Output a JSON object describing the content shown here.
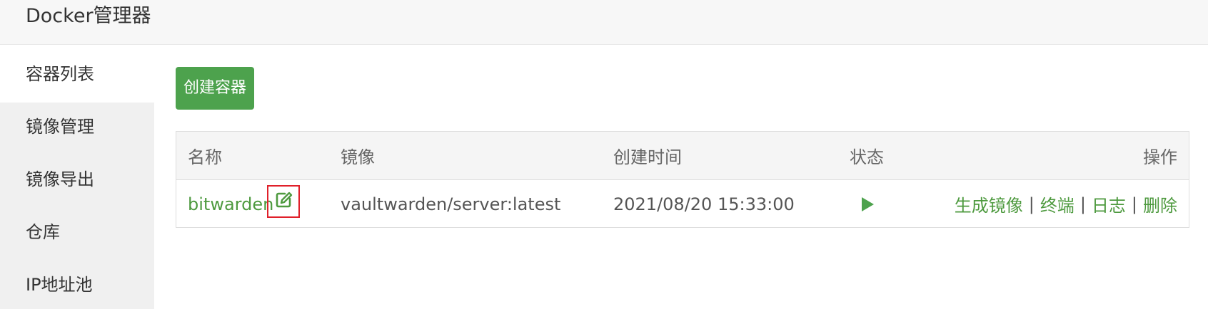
{
  "app": {
    "title": "Docker管理器"
  },
  "sidebar": {
    "items": [
      {
        "label": "容器列表",
        "active": true
      },
      {
        "label": "镜像管理",
        "active": false
      },
      {
        "label": "镜像导出",
        "active": false
      },
      {
        "label": "仓库",
        "active": false
      },
      {
        "label": "IP地址池",
        "active": false
      }
    ]
  },
  "toolbar": {
    "create_label": "创建容器"
  },
  "table": {
    "headers": {
      "name": "名称",
      "image": "镜像",
      "created": "创建时间",
      "status": "状态",
      "ops": "操作"
    },
    "rows": [
      {
        "name": "bitwarden",
        "image": "vaultwarden/server:latest",
        "created": "2021/08/20 15:33:00",
        "status_icon": "play-icon",
        "actions": [
          "生成镜像",
          "终端",
          "日志",
          "删除"
        ],
        "separator": "|"
      }
    ]
  },
  "colors": {
    "accent_green": "#4da24d",
    "link_green": "#4e9a3f",
    "highlight_red": "#e0202a",
    "sidebar_bg": "#f0f0f0"
  },
  "icons": {
    "edit": "edit-icon",
    "status": "play-icon"
  }
}
